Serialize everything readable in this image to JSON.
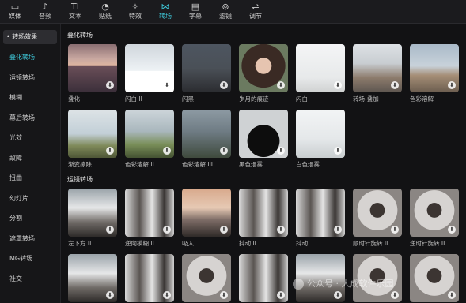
{
  "toolbar": {
    "items": [
      {
        "label": "媒体",
        "icon": "media-icon",
        "glyph": "▭"
      },
      {
        "label": "音频",
        "icon": "audio-icon",
        "glyph": "♪"
      },
      {
        "label": "文本",
        "icon": "text-icon",
        "glyph": "TI"
      },
      {
        "label": "贴纸",
        "icon": "sticker-icon",
        "glyph": "◔"
      },
      {
        "label": "特效",
        "icon": "effects-icon",
        "glyph": "✧"
      },
      {
        "label": "转场",
        "icon": "transition-icon",
        "glyph": "⋈"
      },
      {
        "label": "字幕",
        "icon": "subtitle-icon",
        "glyph": "▤"
      },
      {
        "label": "滤镜",
        "icon": "filter-icon",
        "glyph": "⊚"
      },
      {
        "label": "调节",
        "icon": "adjust-icon",
        "glyph": "⇌"
      }
    ],
    "active_index": 5,
    "accent_color": "#3ec5d6"
  },
  "sidebar": {
    "header": "• 转场效果",
    "items": [
      "叠化转场",
      "运镜转场",
      "模糊",
      "幕后转场",
      "光效",
      "故障",
      "扭曲",
      "幻灯片",
      "分割",
      "遮罩转场",
      "MG转场",
      "社交"
    ],
    "active_index": 0
  },
  "sections": [
    {
      "title": "叠化转场",
      "cards": [
        {
          "name": "叠化",
          "style": "t-sea"
        },
        {
          "name": "闪白 II",
          "style": "t-white"
        },
        {
          "name": "闪黑",
          "style": "t-dark"
        },
        {
          "name": "岁月的痕迹",
          "style": "t-face"
        },
        {
          "name": "闪白",
          "style": "t-fog"
        },
        {
          "name": "转场-叠加",
          "style": "t-dusk"
        },
        {
          "name": "色彩溶解",
          "style": "t-tower"
        },
        {
          "name": "渐变擦除",
          "style": "t-hill"
        },
        {
          "name": "色彩溶解 II",
          "style": "t-hill2"
        },
        {
          "name": "色彩溶解 III",
          "style": "t-sign"
        },
        {
          "name": "黑色烟雾",
          "style": "t-smoke"
        },
        {
          "name": "白色烟雾",
          "style": "t-whitefog"
        }
      ]
    },
    {
      "title": "运镜转场",
      "cards": [
        {
          "name": "左下方 II",
          "style": "t-city"
        },
        {
          "name": "逆向模糊 II",
          "style": "t-cityblur"
        },
        {
          "name": "吸入",
          "style": "t-road"
        },
        {
          "name": "抖动 II",
          "style": "t-cityblur"
        },
        {
          "name": "抖动",
          "style": "t-cityblur"
        },
        {
          "name": "顺时针旋转 II",
          "style": "t-spin"
        },
        {
          "name": "逆时针旋转 II",
          "style": "t-spin"
        },
        {
          "name": "",
          "style": "t-city"
        },
        {
          "name": "",
          "style": "t-cityblur"
        },
        {
          "name": "",
          "style": "t-spin"
        },
        {
          "name": "",
          "style": "t-cityblur"
        },
        {
          "name": "",
          "style": "t-city"
        },
        {
          "name": "",
          "style": "t-spin"
        },
        {
          "name": "",
          "style": "t-spin"
        }
      ]
    }
  ],
  "watermark": "公众号 · 大成软件乐园"
}
